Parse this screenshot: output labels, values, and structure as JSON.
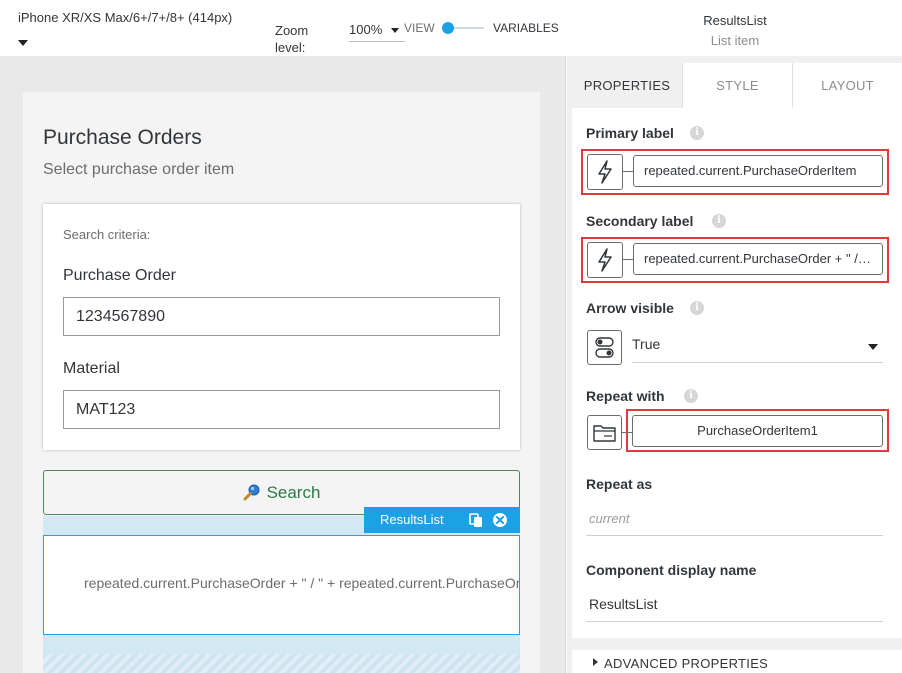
{
  "toolbar": {
    "device": "iPhone XR/XS Max/6+/7+/8+ (414px)",
    "zoom_label": "Zoom level:",
    "zoom_value": "100%",
    "view_label": "VIEW",
    "variables_label": "VARIABLES",
    "selected_component": "ResultsList",
    "selected_type": "List item"
  },
  "canvas": {
    "page_title": "Purchase Orders",
    "page_subtitle": "Select purchase order item",
    "search_criteria_label": "Search criteria:",
    "purchase_order_label": "Purchase Order",
    "purchase_order_value": "1234567890",
    "material_label": "Material",
    "material_value": "MAT123",
    "search_button_label": "Search",
    "results_list_tag": "ResultsList",
    "list_item_text": "repeated.current.PurchaseOrder + \" / \" + repeated.current.PurchaseOrderItem"
  },
  "panel": {
    "tabs": [
      "PROPERTIES",
      "STYLE",
      "LAYOUT"
    ],
    "active_tab": "PROPERTIES",
    "primary_label": {
      "label": "Primary label",
      "value": "repeated.current.PurchaseOrderItem"
    },
    "secondary_label": {
      "label": "Secondary label",
      "value": "repeated.current.PurchaseOrder + \" / \" + repeated.current.PurchaseOrderItem"
    },
    "arrow_visible": {
      "label": "Arrow visible",
      "value": "True"
    },
    "repeat_with": {
      "label": "Repeat with",
      "value": "PurchaseOrderItem1"
    },
    "repeat_as": {
      "label": "Repeat as",
      "placeholder": "current"
    },
    "display_name": {
      "label": "Component display name",
      "value": "ResultsList"
    },
    "advanced": "ADVANCED PROPERTIES"
  },
  "colors": {
    "accent": "#1aa1e6",
    "highlight": "#e0393e",
    "search_green": "#2b7a45"
  },
  "icons": [
    "info-icon",
    "formula-bolt-icon",
    "toggle-icon",
    "data-folder-icon",
    "magnifier-icon",
    "copy-icon",
    "close-icon"
  ]
}
